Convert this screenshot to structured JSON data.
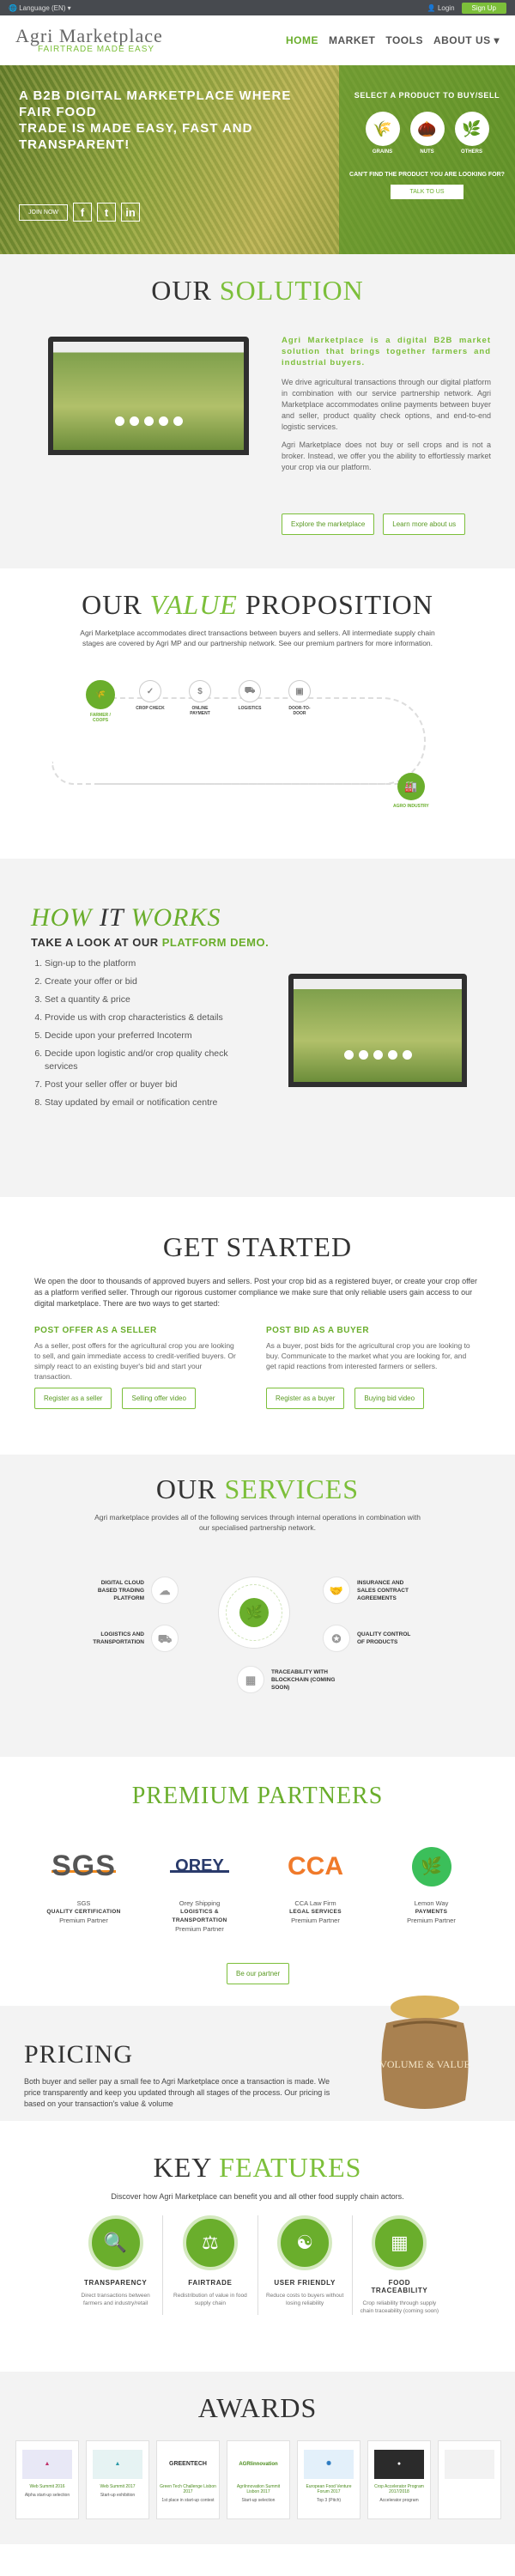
{
  "topbar": {
    "language": "Language (EN)",
    "login": "Login",
    "signup": "Sign Up"
  },
  "header": {
    "logo_main": "Agri Marketplace",
    "logo_sub": "FAIRTRADE MADE EASY",
    "nav": [
      "HOME",
      "MARKET",
      "TOOLS",
      "ABOUT US"
    ]
  },
  "hero": {
    "headline_1": "A B2B DIGITAL MARKETPLACE WHERE FAIR FOOD",
    "headline_2": "TRADE IS MADE EASY, FAST AND TRANSPARENT!",
    "join_label": "JOIN NOW",
    "panel_title": "SELECT A PRODUCT TO BUY/SELL",
    "products": [
      "GRAINS",
      "NUTS",
      "OTHERS"
    ],
    "question": "CAN'T FIND THE PRODUCT YOU ARE LOOKING FOR?",
    "talk_label": "TALK TO US"
  },
  "solution": {
    "title_a": "OUR",
    "title_b": "SOLUTION",
    "lead": "Agri Marketplace is a digital B2B market solution that brings together farmers and industrial buyers.",
    "p1": "We drive agricultural transactions through our digital platform in combination with our service partnership network. Agri Marketplace accommodates online payments between buyer and seller, product quality check options, and end-to-end logistic services.",
    "p2": "Agri Marketplace does not buy or sell crops and is not a broker. Instead, we offer you the ability to effortlessly market your crop via our platform.",
    "btn1": "Explore the marketplace",
    "btn2": "Learn more about us"
  },
  "value": {
    "title_a": "OUR",
    "title_b": "VALUE",
    "title_c": "PROPOSITION",
    "desc": "Agri Marketplace accommodates direct transactions between buyers and sellers. All intermediate supply chain stages are covered by Agri MP and our partnership network. See our premium partners for more information.",
    "steps": [
      "FARMER / COOPS",
      "CROP CHECK",
      "ONLINE PAYMENT",
      "LOGISTICS",
      "DOOR-TO-DOOR"
    ],
    "end": "AGRO INDUSTRY"
  },
  "how": {
    "title_a": "HOW",
    "title_b": "IT",
    "title_c": "WORKS",
    "sub_a": "TAKE A LOOK AT OUR",
    "sub_b": "PLATFORM DEMO.",
    "steps": [
      "Sign-up to the platform",
      "Create your offer or bid",
      "Set a quantity & price",
      "Provide us with crop characteristics & details",
      "Decide upon your preferred Incoterm",
      "Decide upon logistic and/or crop quality check services",
      "Post your seller offer or buyer bid",
      "Stay updated by email or notification centre"
    ]
  },
  "started": {
    "title": "GET STARTED",
    "intro": "We open the door to thousands of approved buyers and sellers. Post your crop bid as a registered buyer, or create your crop offer as a platform verified seller. Through our rigorous customer compliance we make sure that only reliable users gain access to our digital marketplace. There are two ways to get started:",
    "seller_h": "POST OFFER AS A SELLER",
    "seller_p": "As a seller, post offers for the agricultural crop you are looking to sell, and gain immediate access to credit-verified buyers. Or simply react to an existing buyer's bid and start your transaction.",
    "buyer_h": "POST BID AS A BUYER",
    "buyer_p": "As a buyer, post bids for the agricultural crop you are looking to buy. Communicate to the market what you are looking for, and get rapid reactions from interested farmers or sellers.",
    "b1": "Register as a seller",
    "b2": "Selling offer video",
    "b3": "Register as a buyer",
    "b4": "Buying bid video"
  },
  "services": {
    "title_a": "OUR",
    "title_b": "SERVICES",
    "desc": "Agri marketplace provides all of the following services through internal operations in combination with our specialised partnership network.",
    "s1": "DIGITAL CLOUD BASED TRADING PLATFORM",
    "s2": "INSURANCE AND SALES CONTRACT AGREEMENTS",
    "s3": "LOGISTICS AND TRANSPORTATION",
    "s4": "QUALITY CONTROL OF PRODUCTS",
    "s5": "TRACEABILITY WITH BLOCKCHAIN (COMING SOON)"
  },
  "partners": {
    "title": "PREMIUM PARTNERS",
    "items": [
      {
        "logo": "SGS",
        "name": "SGS",
        "role": "QUALITY CERTIFICATION",
        "tier": "Premium Partner"
      },
      {
        "logo": "OREY",
        "name": "Orey Shipping",
        "role": "LOGISTICS & TRANSPORTATION",
        "tier": "Premium Partner"
      },
      {
        "logo": "CCA",
        "name": "CCA Law Firm",
        "role": "LEGAL SERVICES",
        "tier": "Premium Partner"
      },
      {
        "logo": "",
        "name": "Lemon Way",
        "role": "PAYMENTS",
        "tier": "Premium Partner"
      }
    ],
    "btn": "Be our partner"
  },
  "pricing": {
    "title": "PRICING",
    "text": "Both buyer and seller pay a small fee to Agri Marketplace once a transaction is made. We price transparently and keep you updated through all stages of the process. Our pricing is based on your transaction's value & volume",
    "sack": "VOLUME & VALUE"
  },
  "features": {
    "title_a": "KEY",
    "title_b": "FEATURES",
    "desc": "Discover how Agri Marketplace can benefit you and all other food supply chain actors.",
    "items": [
      {
        "h": "TRANSPARENCY",
        "p": "Direct transactions between farmers and industry/retail"
      },
      {
        "h": "FAIRTRADE",
        "p": "Redistribution of value in food supply chain"
      },
      {
        "h": "USER FRIENDLY",
        "p": "Reduce costs to buyers without losing reliability"
      },
      {
        "h": "FOOD TRACEABILITY",
        "p": "Crop reliability through supply chain traceability (coming soon)"
      }
    ]
  },
  "awards": {
    "title": "AWARDS",
    "row1": [
      {
        "logo": "",
        "lab": "Web Summit 2016",
        "sub": "Alpha start-up selection"
      },
      {
        "logo": "",
        "lab": "Web Summit 2017",
        "sub": "Start-up exhibition"
      },
      {
        "logo": "GREENTECH",
        "lab": "Green Tech Challenge Lisbon 2017",
        "sub": "1st place in start-up contest"
      },
      {
        "logo": "AGRIinnovation",
        "lab": "AgriInnovation Summit Lisbon 2017",
        "sub": "Start-up selection"
      },
      {
        "logo": "",
        "lab": "European Food Venture Forum 2017",
        "sub": "Top 3 (Pitch)"
      },
      {
        "logo": "",
        "lab": "Crop Accelerator Program 2017/2018",
        "sub": "Accelerator program"
      },
      {
        "logo": "",
        "lab": "",
        "sub": ""
      }
    ],
    "row2": [
      {
        "logo": "",
        "lab": "",
        "sub": ""
      },
      {
        "logo": "",
        "lab": "",
        "sub": ""
      },
      {
        "logo": "",
        "lab": "",
        "sub": ""
      },
      {
        "logo": "",
        "lab": "",
        "sub": ""
      },
      {
        "logo": "",
        "lab": "",
        "sub": ""
      },
      {
        "logo": "",
        "lab": "",
        "sub": ""
      },
      {
        "logo": "",
        "lab": "",
        "sub": ""
      }
    ]
  },
  "colors": {
    "brand": "#7cbf3a",
    "dark": "#474a4f"
  }
}
